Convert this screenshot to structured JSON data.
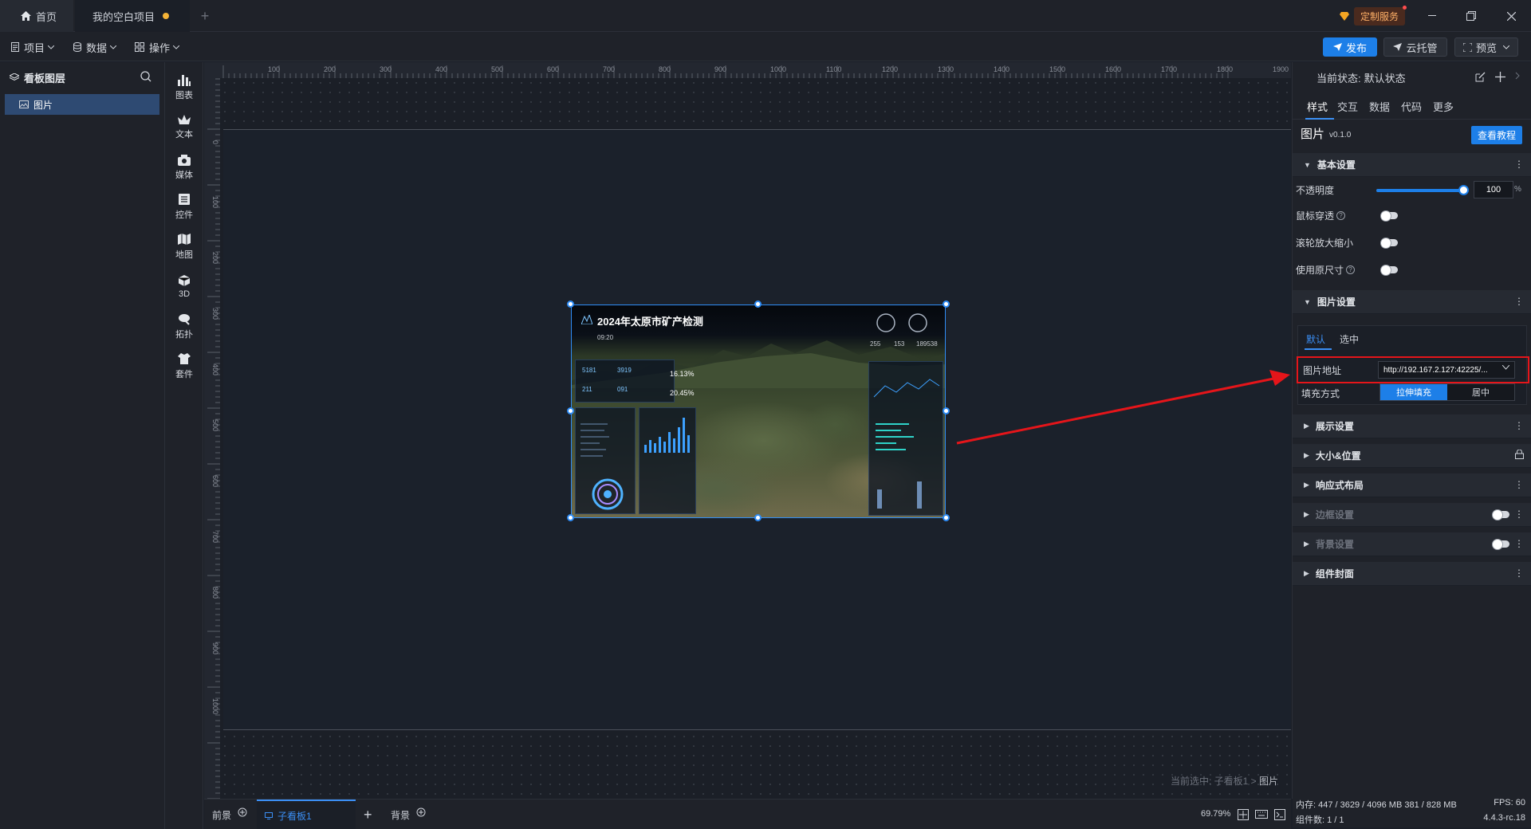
{
  "titlebar": {
    "tabs": [
      {
        "label": "首页"
      },
      {
        "label": "我的空白项目"
      }
    ],
    "custom_service": "定制服务"
  },
  "toolbar": {
    "menus": [
      {
        "label": "项目"
      },
      {
        "label": "数据"
      },
      {
        "label": "操作"
      }
    ],
    "publish": "发布",
    "cloud": "云托管",
    "preview": "预览"
  },
  "layers": {
    "title": "看板图层",
    "items": [
      {
        "label": "图片"
      }
    ]
  },
  "components": [
    {
      "label": "图表",
      "icon": "bar-chart-icon"
    },
    {
      "label": "文本",
      "icon": "text-icon"
    },
    {
      "label": "媒体",
      "icon": "media-icon"
    },
    {
      "label": "控件",
      "icon": "widget-icon"
    },
    {
      "label": "地图",
      "icon": "map-icon"
    },
    {
      "label": "3D",
      "icon": "cube-icon"
    },
    {
      "label": "拓扑",
      "icon": "topology-icon"
    },
    {
      "label": "套件",
      "icon": "suite-icon"
    }
  ],
  "ruler": {
    "h_ticks": [
      "100",
      "200",
      "300",
      "400",
      "500",
      "600",
      "700",
      "800",
      "900",
      "1000",
      "1100",
      "1200",
      "1300",
      "1400",
      "1500",
      "1600",
      "1700",
      "1800",
      "1900"
    ],
    "v_ticks": [
      "0",
      "100",
      "200",
      "300",
      "400",
      "500",
      "600",
      "700",
      "800",
      "900",
      "1000"
    ]
  },
  "canvas": {
    "selection_prefix": "当前选中: 子看板1 >",
    "selection_current": "图片",
    "image": {
      "title": "2024年太原市矿产检测",
      "time": "09:20",
      "stats": [
        "5181",
        "3919",
        "211",
        "091"
      ],
      "pct1": "16.13%",
      "pct2": "20.45%",
      "right_nums": [
        "255",
        "153",
        "189538"
      ]
    }
  },
  "bottombar": {
    "tabs": [
      {
        "label": "前景"
      },
      {
        "label": "子看板1"
      },
      {
        "label": "背景"
      }
    ],
    "zoom": "69.79%"
  },
  "rpanel": {
    "state_label": "当前状态:",
    "state_value": "默认状态",
    "tabs": [
      {
        "label": "样式"
      },
      {
        "label": "交互"
      },
      {
        "label": "数据"
      },
      {
        "label": "代码"
      },
      {
        "label": "更多"
      }
    ],
    "component_name": "图片",
    "component_version": "v0.1.0",
    "tutorial": "查看教程",
    "basic": {
      "title": "基本设置",
      "opacity_label": "不透明度",
      "opacity_value": "100",
      "opacity_fraction": 1.0,
      "opacity_unit": "%",
      "mouse_through": "鼠标穿透",
      "wheel_zoom": "滚轮放大缩小",
      "original_size": "使用原尺寸"
    },
    "image_settings": {
      "title": "图片设置",
      "subtabs": [
        {
          "label": "默认"
        },
        {
          "label": "选中"
        }
      ],
      "url_label": "图片地址",
      "url_value": "http://192.167.2.127:42225/...",
      "fill_label": "填充方式",
      "fill_options": [
        {
          "label": "拉伸填充"
        },
        {
          "label": "居中"
        }
      ]
    },
    "sections": [
      {
        "label": "展示设置"
      },
      {
        "label": "大小&位置"
      },
      {
        "label": "响应式布局"
      },
      {
        "label": "边框设置"
      },
      {
        "label": "背景设置"
      },
      {
        "label": "组件封面"
      }
    ],
    "status": {
      "memory": "内存: 447 / 3629 / 4096 MB 381 / 828 MB",
      "fps": "FPS: 60",
      "components": "组件数: 1 / 1",
      "version": "4.4.3-rc.18"
    }
  },
  "colors": {
    "accent": "#1d7fe8",
    "highlight_box": "#e5151a",
    "unsaved_dot": "#f5b437"
  }
}
